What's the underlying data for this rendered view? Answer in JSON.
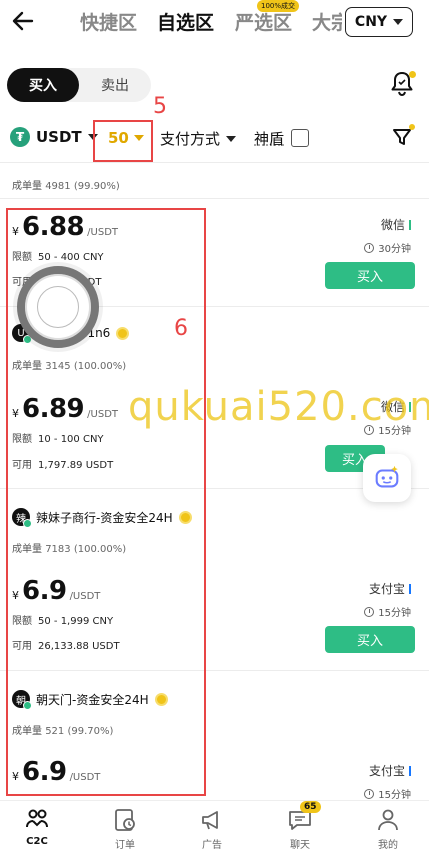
{
  "nav": {
    "tabs": [
      "快捷区",
      "自选区",
      "严选区",
      "大宗"
    ],
    "active_tab": "自选区",
    "select_badge": "100%成交",
    "currency": "CNY"
  },
  "mode": {
    "buy": "买入",
    "sell": "卖出"
  },
  "annotations": {
    "five": "5",
    "six": "6"
  },
  "filters": {
    "coin": "USDT",
    "amount": "50",
    "payment": "支付方式",
    "shield": "神盾"
  },
  "partial_top": {
    "label": "成单量",
    "value": "4981 (99.90%)"
  },
  "listings": [
    {
      "merchant": "",
      "merchant_initial": "",
      "orders_label": "",
      "orders": "",
      "currency_symbol": "¥",
      "price": "6.88",
      "unit": "/USDT",
      "limit_label": "限额",
      "limit": "50 - 400 CNY",
      "available_label": "可用",
      "available": "USDT",
      "payment": "微信",
      "time": "30分钟",
      "button": "买入"
    },
    {
      "merchant": "...1n6",
      "merchant_initial": "U",
      "orders_label": "成单量",
      "orders": "3145 (100.00%)",
      "currency_symbol": "¥",
      "price": "6.89",
      "unit": "/USDT",
      "limit_label": "限额",
      "limit": "10 - 100 CNY",
      "available_label": "可用",
      "available": "1,797.89 USDT",
      "payment": "微信",
      "time": "15分钟",
      "button": "买入"
    },
    {
      "merchant": "辣妹子商行-资金安全24H",
      "merchant_initial": "辣",
      "orders_label": "成单量",
      "orders": "7183 (100.00%)",
      "currency_symbol": "¥",
      "price": "6.9",
      "unit": "/USDT",
      "limit_label": "限额",
      "limit": "50 - 1,999 CNY",
      "available_label": "可用",
      "available": "26,133.88 USDT",
      "payment": "支付宝",
      "time": "15分钟",
      "button": "买入"
    },
    {
      "merchant": "朝天门-资金安全24H",
      "merchant_initial": "朝",
      "orders_label": "成单量",
      "orders": "521 (99.70%)",
      "currency_symbol": "¥",
      "price": "6.9",
      "unit": "/USDT",
      "payment": "支付宝",
      "time": "15分钟"
    }
  ],
  "watermark": "qukuai520.com",
  "tabbar": {
    "c2c": "C2C",
    "orders": "订单",
    "ads": "广告",
    "chat": "聊天",
    "chat_badge": "65",
    "me": "我的"
  },
  "colors": {
    "buy_green": "#2ebd85",
    "accent_yellow": "#f0c419",
    "annotation_red": "#e84545",
    "amount_yellow": "#e0a800"
  }
}
